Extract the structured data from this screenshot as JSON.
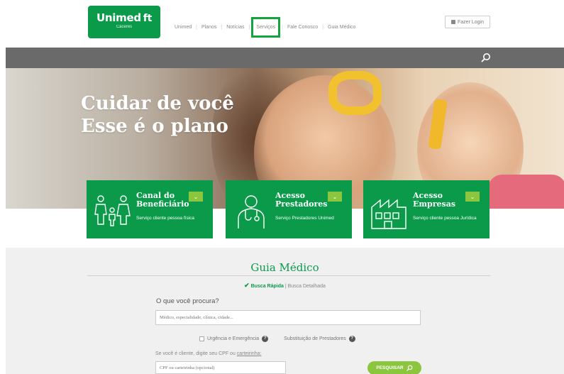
{
  "header": {
    "logo": {
      "brand": "Unimed",
      "city": "Cáceres"
    },
    "nav": [
      "Unimed",
      "Planos",
      "Notícias",
      "Serviços",
      "Fale Conosco",
      "Guia Médico"
    ],
    "active_nav": "Serviços",
    "login_label": "Fazer Login"
  },
  "hero": {
    "line1": "Cuidar de você",
    "line2": "Esse é o plano"
  },
  "cards": [
    {
      "title1": "Canal do",
      "title2": "Beneficiário",
      "sub": "Serviço cliente pessoa física",
      "icon": "family-icon"
    },
    {
      "title1": "Acesso",
      "title2": "Prestadores",
      "sub": "Serviço Prestadores Unimed",
      "icon": "doctor-icon"
    },
    {
      "title1": "Acesso",
      "title2": "Empresas",
      "sub": "Serviço cliente pessoa Jurídica",
      "icon": "factory-icon"
    }
  ],
  "guia": {
    "title": "Guia Médico",
    "tab_rapida": "Busca Rápida",
    "tab_detalhada": "Busca Detalhada",
    "question": "O que você procura?",
    "search_placeholder": "Médico, especialidade, clínica, cidade...",
    "opt_urgencia": "Urgência e Emergência",
    "opt_substituicao": "Substituição de Prestadores",
    "cpf_prompt": "Se você é cliente, digite seu CPF ou",
    "cpf_link": "carteirinha:",
    "cpf_placeholder": "CPF ou carteirinha (opcional)",
    "search_button": "PESQUISAR"
  },
  "colors": {
    "brand_green": "#0a9a4a",
    "accent_light_green": "#8cc63f",
    "bar_gray": "#6a6a6a"
  }
}
